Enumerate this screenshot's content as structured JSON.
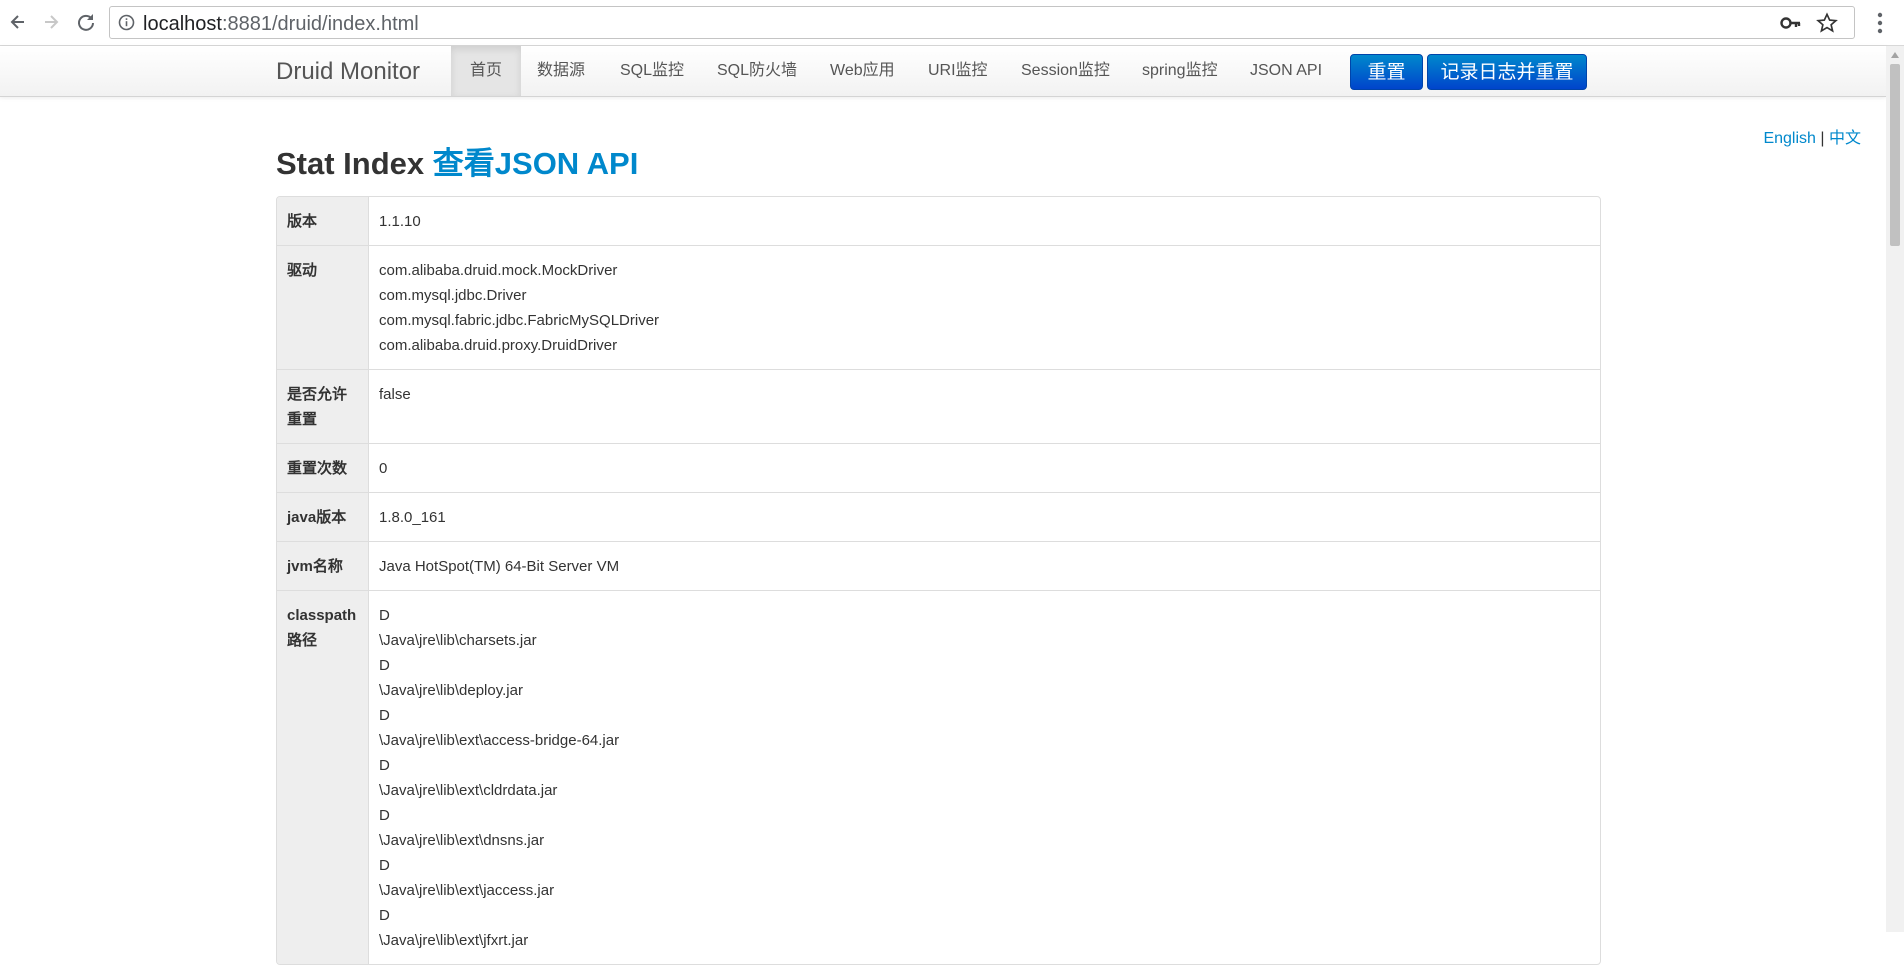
{
  "browser": {
    "url_host": "localhost",
    "url_rest": ":8881/druid/index.html"
  },
  "navbar": {
    "brand": "Druid Monitor",
    "items": [
      "首页",
      "数据源",
      "SQL监控",
      "SQL防火墙",
      "Web应用",
      "URI监控",
      "Session监控",
      "spring监控",
      "JSON API"
    ],
    "reset_label": "重置",
    "log_reset_label": "记录日志并重置"
  },
  "lang": {
    "english": "English",
    "separator": "|",
    "chinese": "中文"
  },
  "page": {
    "title": "Stat Index",
    "json_link": "查看JSON API"
  },
  "table": {
    "rows": [
      {
        "label": "版本",
        "value": [
          "1.1.10"
        ]
      },
      {
        "label": "驱动",
        "value": [
          "com.alibaba.druid.mock.MockDriver",
          "com.mysql.jdbc.Driver",
          "com.mysql.fabric.jdbc.FabricMySQLDriver",
          "com.alibaba.druid.proxy.DruidDriver"
        ]
      },
      {
        "label": "是否允许重置",
        "value": [
          "false"
        ]
      },
      {
        "label": "重置次数",
        "value": [
          "0"
        ]
      },
      {
        "label": "java版本",
        "value": [
          "1.8.0_161"
        ]
      },
      {
        "label": "jvm名称",
        "value": [
          "Java HotSpot(TM) 64-Bit Server VM"
        ]
      },
      {
        "label": "classpath路径",
        "value": [
          "D",
          "\\Java\\jre\\lib\\charsets.jar",
          "D",
          "\\Java\\jre\\lib\\deploy.jar",
          "D",
          "\\Java\\jre\\lib\\ext\\access-bridge-64.jar",
          "D",
          "\\Java\\jre\\lib\\ext\\cldrdata.jar",
          "D",
          "\\Java\\jre\\lib\\ext\\dnsns.jar",
          "D",
          "\\Java\\jre\\lib\\ext\\jaccess.jar",
          "D",
          "\\Java\\jre\\lib\\ext\\jfxrt.jar"
        ]
      }
    ]
  }
}
